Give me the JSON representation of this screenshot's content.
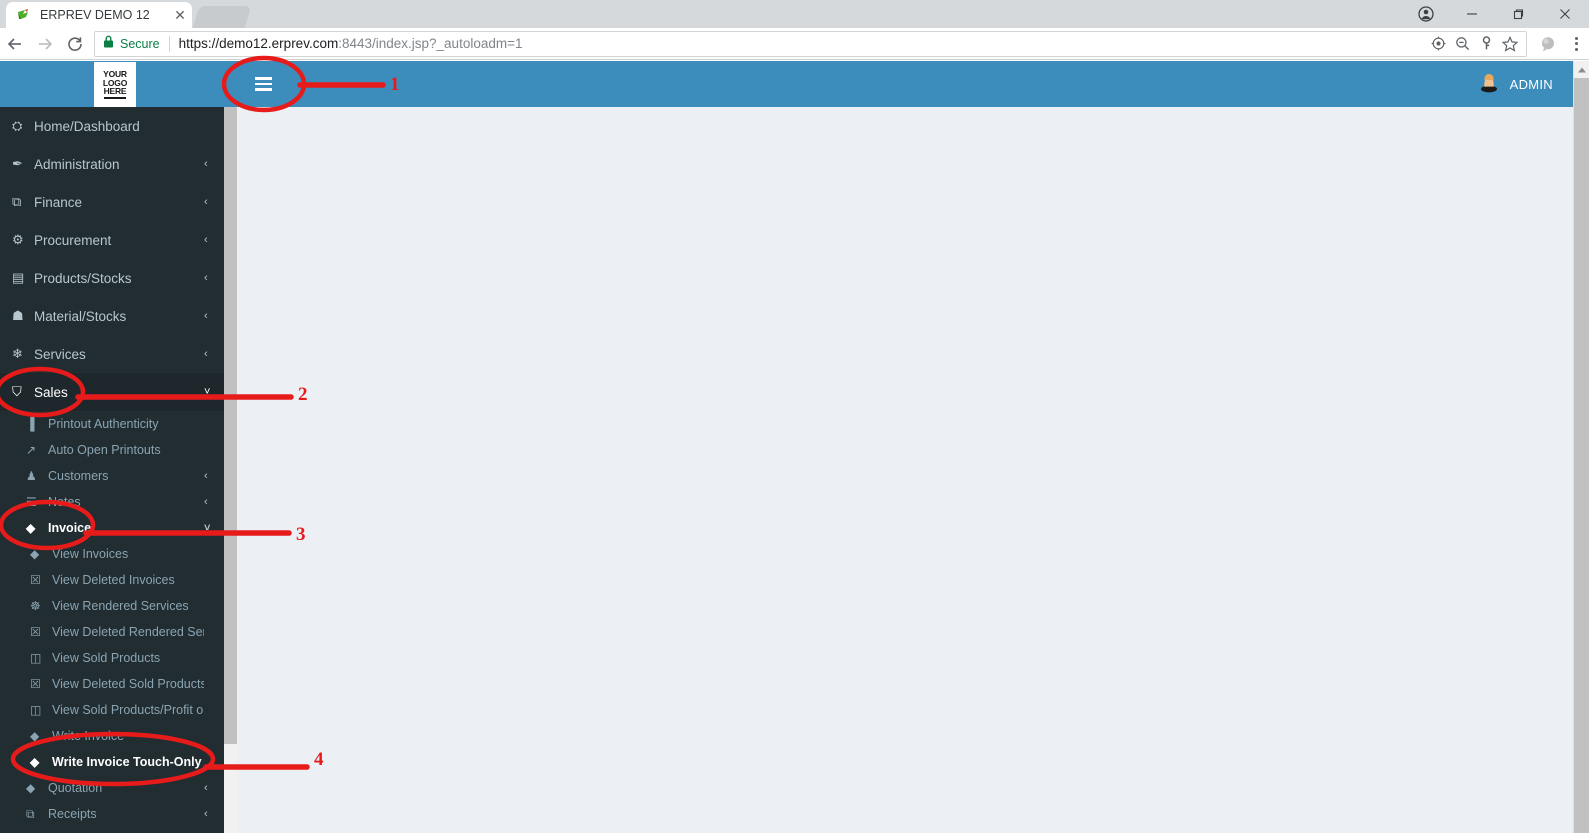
{
  "browser": {
    "tab": {
      "title": "ERPREV DEMO 12",
      "favicon": "bird-favicon",
      "close_label": "✕"
    },
    "window_controls": {
      "profile": "profile-icon",
      "minimize": "—",
      "maximize": "❐",
      "close": "✕"
    },
    "nav": {
      "back": "←",
      "forward": "→",
      "reload": "⟳"
    },
    "omnibox": {
      "security_label": "Secure",
      "url_scheme": "https://",
      "url_host": "demo12.erprev.com",
      "url_port": ":8443",
      "url_path": "/index.jsp?_autoloadm=1",
      "url_full": "https://demo12.erprev.com:8443/index.jsp?_autoloadm=1",
      "icons": [
        "location-icon",
        "zoom-out-icon",
        "key-icon",
        "star-icon"
      ]
    },
    "extension_icon": "extension-icon",
    "menu_icon": "three-dot-menu-icon"
  },
  "app": {
    "header": {
      "logo_lines": [
        "YOUR",
        "LOGO",
        "HERE"
      ],
      "menu_toggle_icon": "hamburger-icon",
      "user_name": "ADMIN",
      "avatar_icon": "user-avatar-icon",
      "bg_color": "#3c8dbc"
    },
    "sidebar": {
      "bg_color": "#222d32",
      "active_bg_color": "#1e282c",
      "items": [
        {
          "label": "Home/Dashboard",
          "icon": "dashboard-icon",
          "glyph": "⛭",
          "level": 0,
          "arrow": "",
          "state": "normal"
        },
        {
          "label": "Administration",
          "icon": "admin-tools-icon",
          "glyph": "✒",
          "level": 0,
          "arrow": "‹",
          "state": "normal"
        },
        {
          "label": "Finance",
          "icon": "money-icon",
          "glyph": "⧉",
          "level": 0,
          "arrow": "‹",
          "state": "normal"
        },
        {
          "label": "Procurement",
          "icon": "procurement-icon",
          "glyph": "⚙",
          "level": 0,
          "arrow": "‹",
          "state": "normal"
        },
        {
          "label": "Products/Stocks",
          "icon": "products-icon",
          "glyph": "▤",
          "level": 0,
          "arrow": "‹",
          "state": "normal"
        },
        {
          "label": "Material/Stocks",
          "icon": "material-icon",
          "glyph": "☗",
          "level": 0,
          "arrow": "‹",
          "state": "normal"
        },
        {
          "label": "Services",
          "icon": "services-icon",
          "glyph": "❄",
          "level": 0,
          "arrow": "‹",
          "state": "normal"
        },
        {
          "label": "Sales",
          "icon": "cart-icon",
          "glyph": "⛉",
          "level": 0,
          "arrow": "˅",
          "state": "active"
        },
        {
          "label": "Printout Authenticity",
          "icon": "barcode-icon",
          "glyph": "▐",
          "level": 1,
          "arrow": "",
          "state": "normal"
        },
        {
          "label": "Auto Open Printouts",
          "icon": "external-link-icon",
          "glyph": "↗",
          "level": 1,
          "arrow": "",
          "state": "normal"
        },
        {
          "label": "Customers",
          "icon": "user-icon",
          "glyph": "♟",
          "level": 1,
          "arrow": "‹",
          "state": "normal"
        },
        {
          "label": "Notes",
          "icon": "document-icon",
          "glyph": "☰",
          "level": 1,
          "arrow": "‹",
          "state": "normal"
        },
        {
          "label": "Invoice",
          "icon": "tag-icon",
          "glyph": "◆",
          "level": 1,
          "arrow": "˅",
          "state": "sub-active"
        },
        {
          "label": "View Invoices",
          "icon": "tag-icon",
          "glyph": "◆",
          "level": 2,
          "arrow": "",
          "state": "normal"
        },
        {
          "label": "View Deleted Invoices",
          "icon": "trash-icon",
          "glyph": "☒",
          "level": 2,
          "arrow": "",
          "state": "normal"
        },
        {
          "label": "View Rendered Services",
          "icon": "gear-icon",
          "glyph": "☸",
          "level": 2,
          "arrow": "",
          "state": "normal"
        },
        {
          "label": "View Deleted Rendered Services",
          "icon": "trash-icon",
          "glyph": "☒",
          "level": 2,
          "arrow": "",
          "state": "normal"
        },
        {
          "label": "View Sold Products",
          "icon": "box-icon",
          "glyph": "◫",
          "level": 2,
          "arrow": "",
          "state": "normal"
        },
        {
          "label": "View Deleted Sold Products",
          "icon": "trash-icon",
          "glyph": "☒",
          "level": 2,
          "arrow": "",
          "state": "normal"
        },
        {
          "label": "View Sold Products/Profit on sales",
          "icon": "box-icon",
          "glyph": "◫",
          "level": 2,
          "arrow": "",
          "state": "normal"
        },
        {
          "label": "Write Invoice",
          "icon": "tag-icon",
          "glyph": "◆",
          "level": 2,
          "arrow": "",
          "state": "normal"
        },
        {
          "label": "Write Invoice Touch-Only",
          "icon": "tag-icon",
          "glyph": "◆",
          "level": 2,
          "arrow": "",
          "state": "sub-active"
        },
        {
          "label": "Quotation",
          "icon": "tags-icon",
          "glyph": "◆",
          "level": 1,
          "arrow": "‹",
          "state": "normal"
        },
        {
          "label": "Receipts",
          "icon": "money-icon",
          "glyph": "⧉",
          "level": 1,
          "arrow": "‹",
          "state": "normal"
        }
      ]
    },
    "content": {
      "bg_color": "#ecf0f5"
    }
  },
  "annotations": {
    "color": "#e81b1b",
    "markers": [
      {
        "number": "1",
        "target": "hamburger-icon"
      },
      {
        "number": "2",
        "target": "sidebar-item-sales"
      },
      {
        "number": "3",
        "target": "sidebar-item-invoice"
      },
      {
        "number": "4",
        "target": "sidebar-item-write-invoice-touch-only"
      }
    ]
  }
}
